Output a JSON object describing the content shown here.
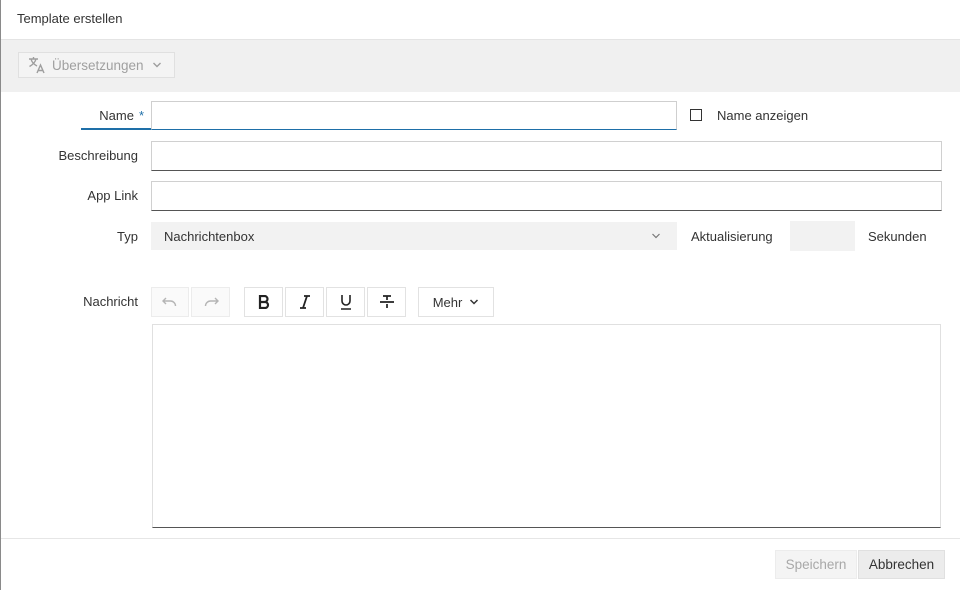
{
  "dialog": {
    "title": "Template erstellen"
  },
  "toolbar": {
    "translations_label": "Übersetzungen"
  },
  "form": {
    "name_label": "Name",
    "name_required": "*",
    "name_value": "",
    "show_name_label": "Name anzeigen",
    "show_name_checked": false,
    "description_label": "Beschreibung",
    "description_value": "",
    "app_link_label": "App Link",
    "app_link_value": "",
    "type_label": "Typ",
    "type_value": "Nachrichtenbox",
    "refresh_label": "Aktualisierung",
    "refresh_value": "",
    "seconds_label": "Sekunden",
    "message_label": "Nachricht"
  },
  "editor_toolbar": {
    "undo_icon": "undo-icon",
    "redo_icon": "redo-icon",
    "bold_icon": "bold-icon",
    "italic_icon": "italic-icon",
    "underline_icon": "underline-icon",
    "strikethrough_icon": "strikethrough-icon",
    "more_label": "Mehr"
  },
  "footer": {
    "save_label": "Speichern",
    "cancel_label": "Abbrechen"
  },
  "colors": {
    "accent": "#1e6fa8",
    "toolbar_bg": "#f0f0f0"
  }
}
